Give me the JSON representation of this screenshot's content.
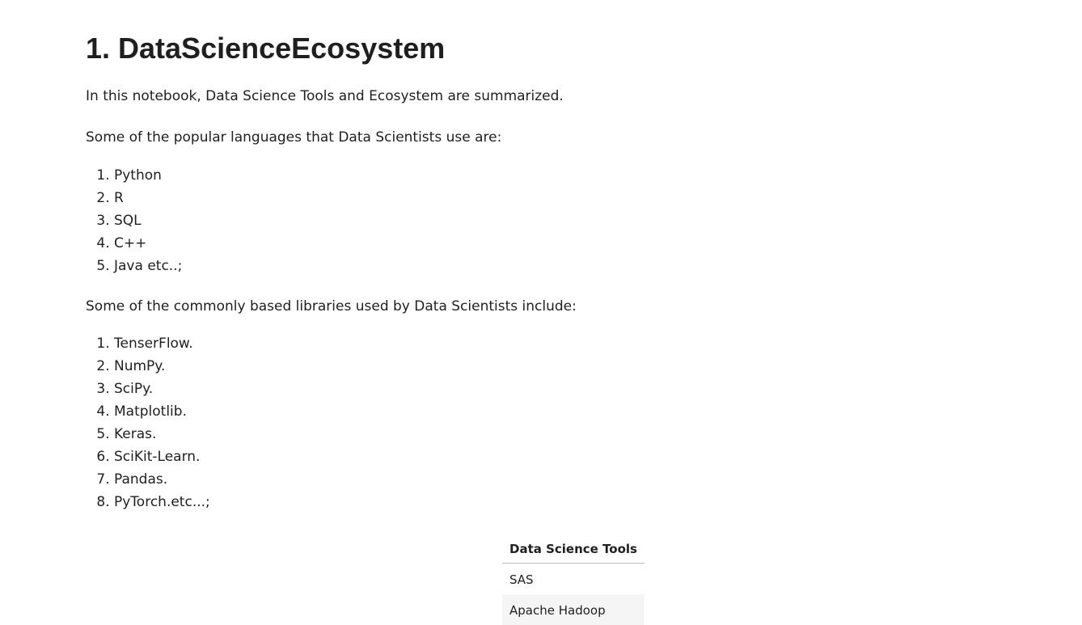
{
  "heading": "1. DataScienceEcosystem",
  "intro": "In this notebook, Data Science Tools and Ecosystem are summarized.",
  "languages": {
    "lead": "Some of the popular languages that Data Scientists use are:",
    "items": [
      "Python",
      "R",
      "SQL",
      "C++",
      "Java etc..;"
    ]
  },
  "libraries": {
    "lead": "Some of the commonly based libraries used by Data Scientists include:",
    "items": [
      "TenserFlow.",
      "NumPy.",
      "SciPy.",
      "Matplotlib.",
      "Keras.",
      "SciKit-Learn.",
      "Pandas.",
      "PyTorch.etc...;"
    ]
  },
  "tools_table": {
    "header": "Data Science Tools",
    "rows": [
      "SAS",
      "Apache Hadoop"
    ]
  }
}
